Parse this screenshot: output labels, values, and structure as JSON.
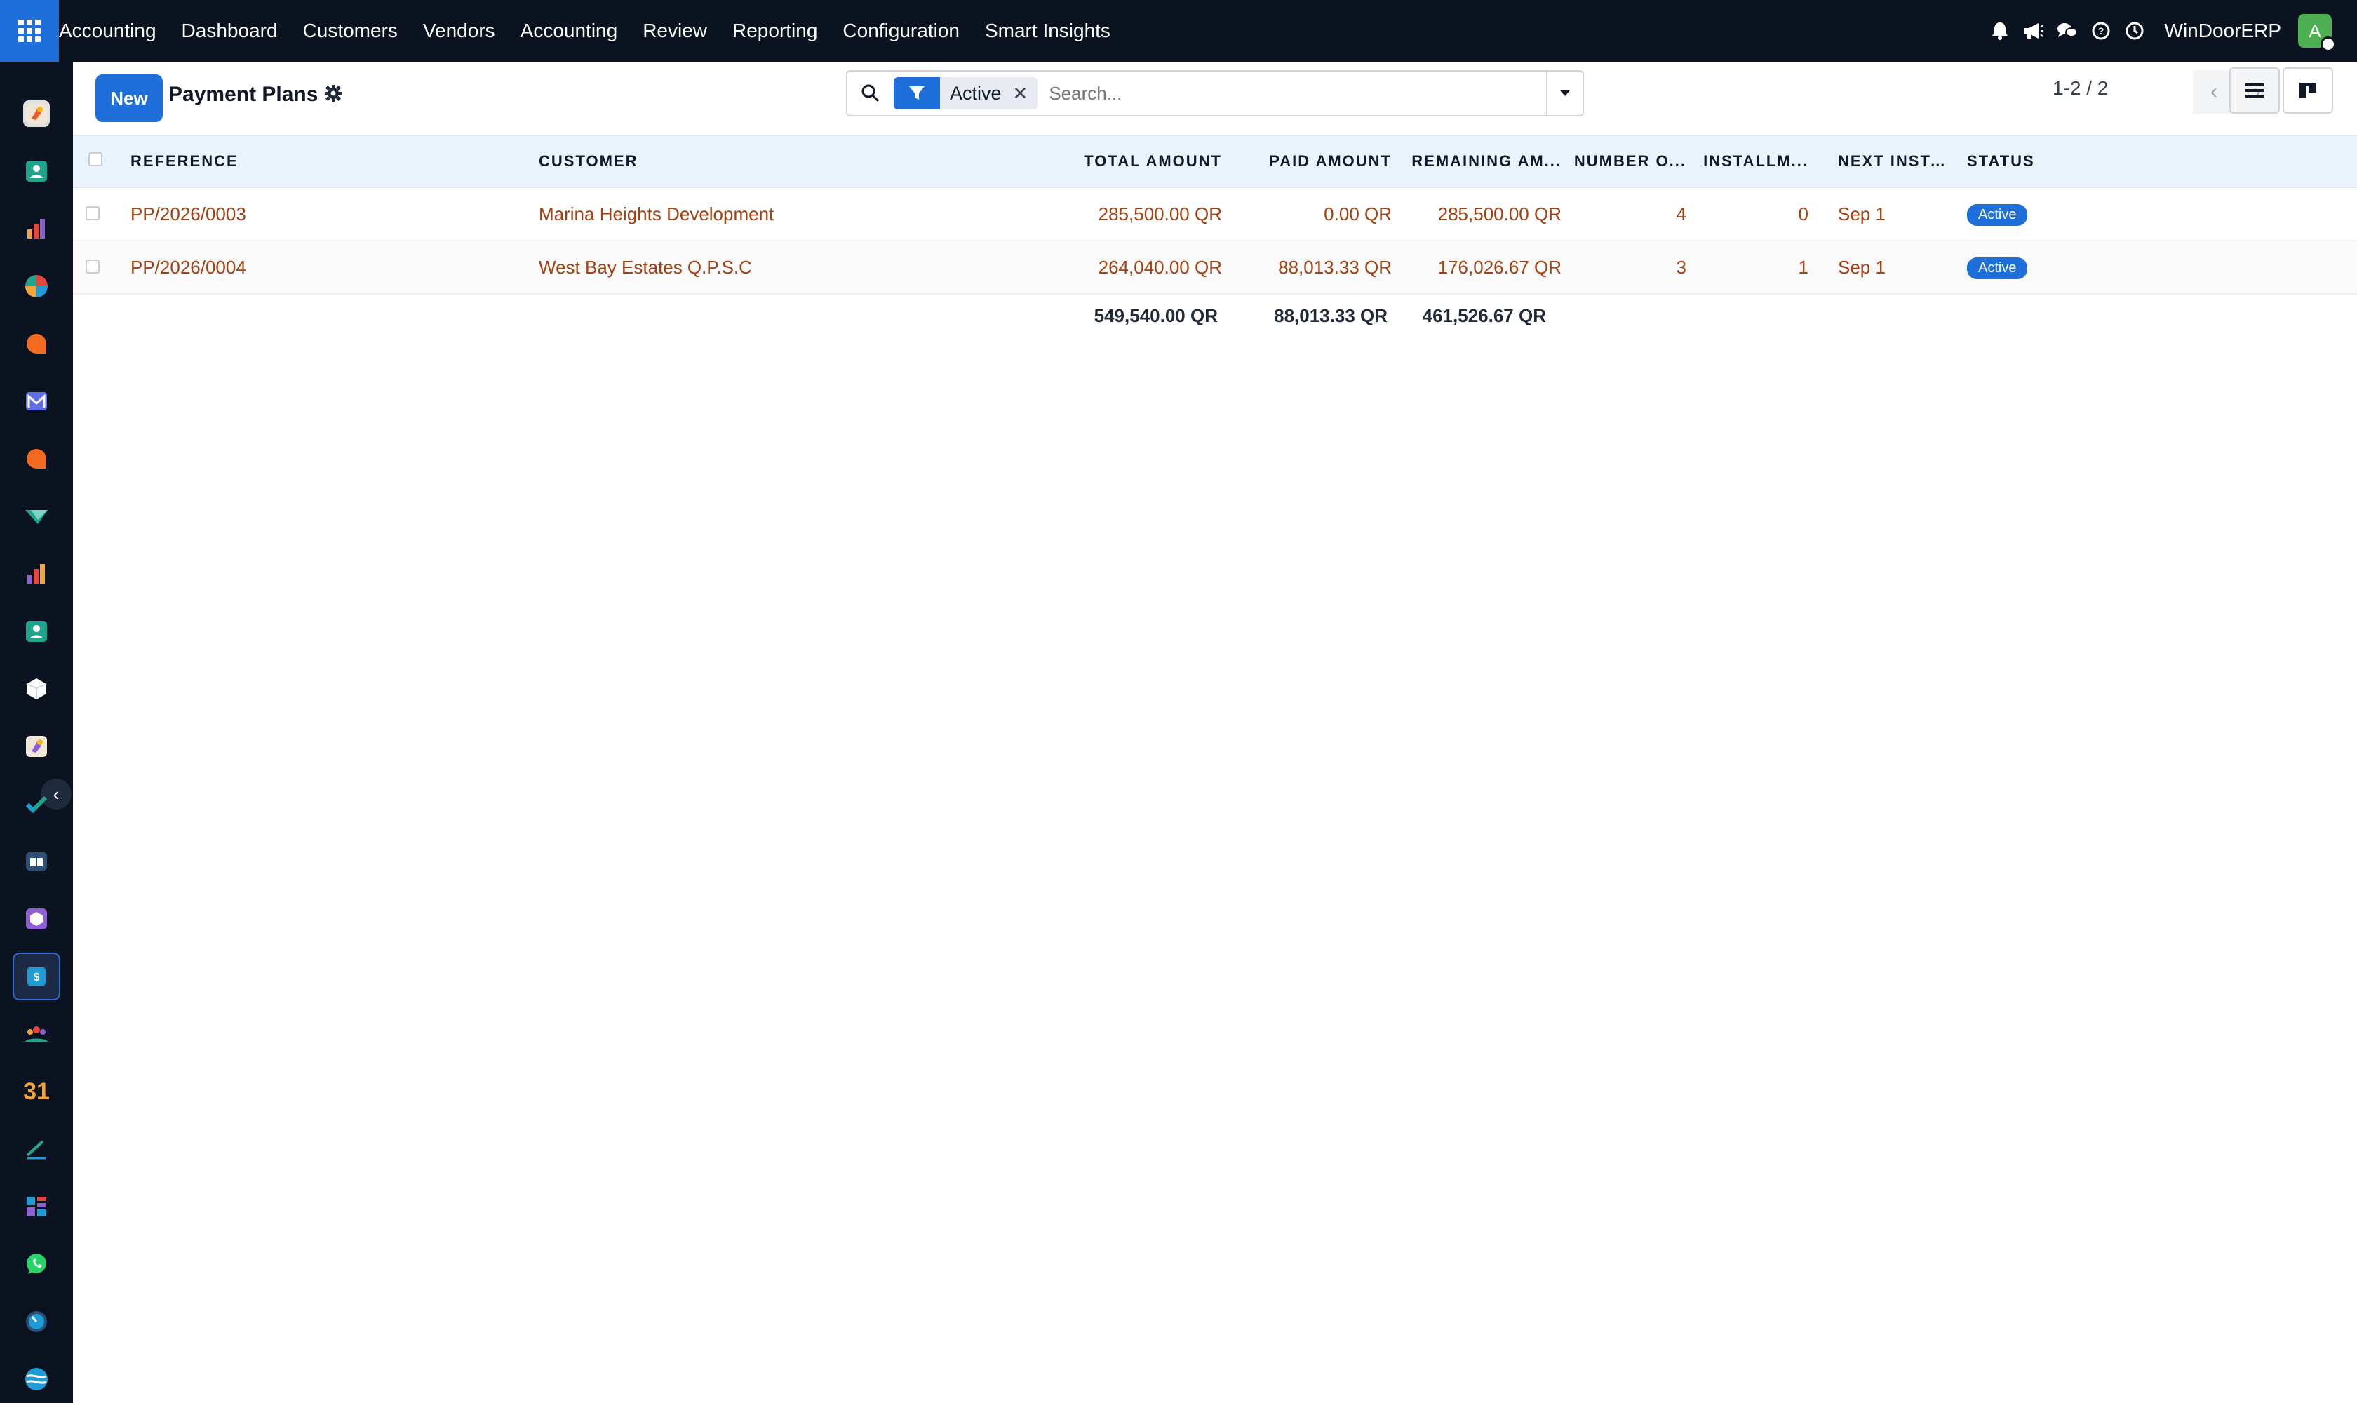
{
  "app": {
    "name": "Accounting",
    "company": "WinDoorERP",
    "avatar_letter": "A"
  },
  "menu": [
    "Dashboard",
    "Customers",
    "Vendors",
    "Accounting",
    "Review",
    "Reporting",
    "Configuration",
    "Smart Insights"
  ],
  "colors": {
    "topbar": "#0b1220",
    "accent": "#1e6fd9",
    "link": "#a4400f"
  },
  "control": {
    "new_label": "New",
    "title": "Payment Plans",
    "filter_facet": "Active",
    "search_placeholder": "Search...",
    "pager": "1-2 / 2"
  },
  "table": {
    "columns": [
      "REFERENCE",
      "CUSTOMER",
      "TOTAL AMOUNT",
      "PAID AMOUNT",
      "REMAINING AM...",
      "NUMBER O...",
      "INSTALLM...",
      "NEXT INSTAL...",
      "STATUS"
    ],
    "rows": [
      {
        "reference": "PP/2026/0003",
        "customer": "Marina Heights Development",
        "total": "285,500.00 QR",
        "paid": "0.00 QR",
        "remaining": "285,500.00 QR",
        "number": "4",
        "installments": "0",
        "next": "Sep 1",
        "status": "Active"
      },
      {
        "reference": "PP/2026/0004",
        "customer": "West Bay Estates Q.P.S.C",
        "total": "264,040.00 QR",
        "paid": "88,013.33 QR",
        "remaining": "176,026.67 QR",
        "number": "3",
        "installments": "1",
        "next": "Sep 1",
        "status": "Active"
      }
    ],
    "totals": {
      "total": "549,540.00 QR",
      "paid": "88,013.33 QR",
      "remaining": "461,526.67 QR"
    }
  },
  "sidebar_icons": [
    "sales-icon",
    "contacts-icon",
    "reporting-icon",
    "dashboard-icon",
    "discuss-icon",
    "email-marketing-icon",
    "chat-icon",
    "documents-icon",
    "analytics-icon",
    "employees-icon",
    "inventory-icon",
    "payroll-icon",
    "project-icon",
    "knowledge-icon",
    "product-icon",
    "invoicing-icon",
    "team-icon",
    "calendar-icon",
    "sign-icon",
    "spreadsheet-icon",
    "whatsapp-icon",
    "timer-icon",
    "apps-store-icon"
  ],
  "sidebar_calendar_text": "31"
}
